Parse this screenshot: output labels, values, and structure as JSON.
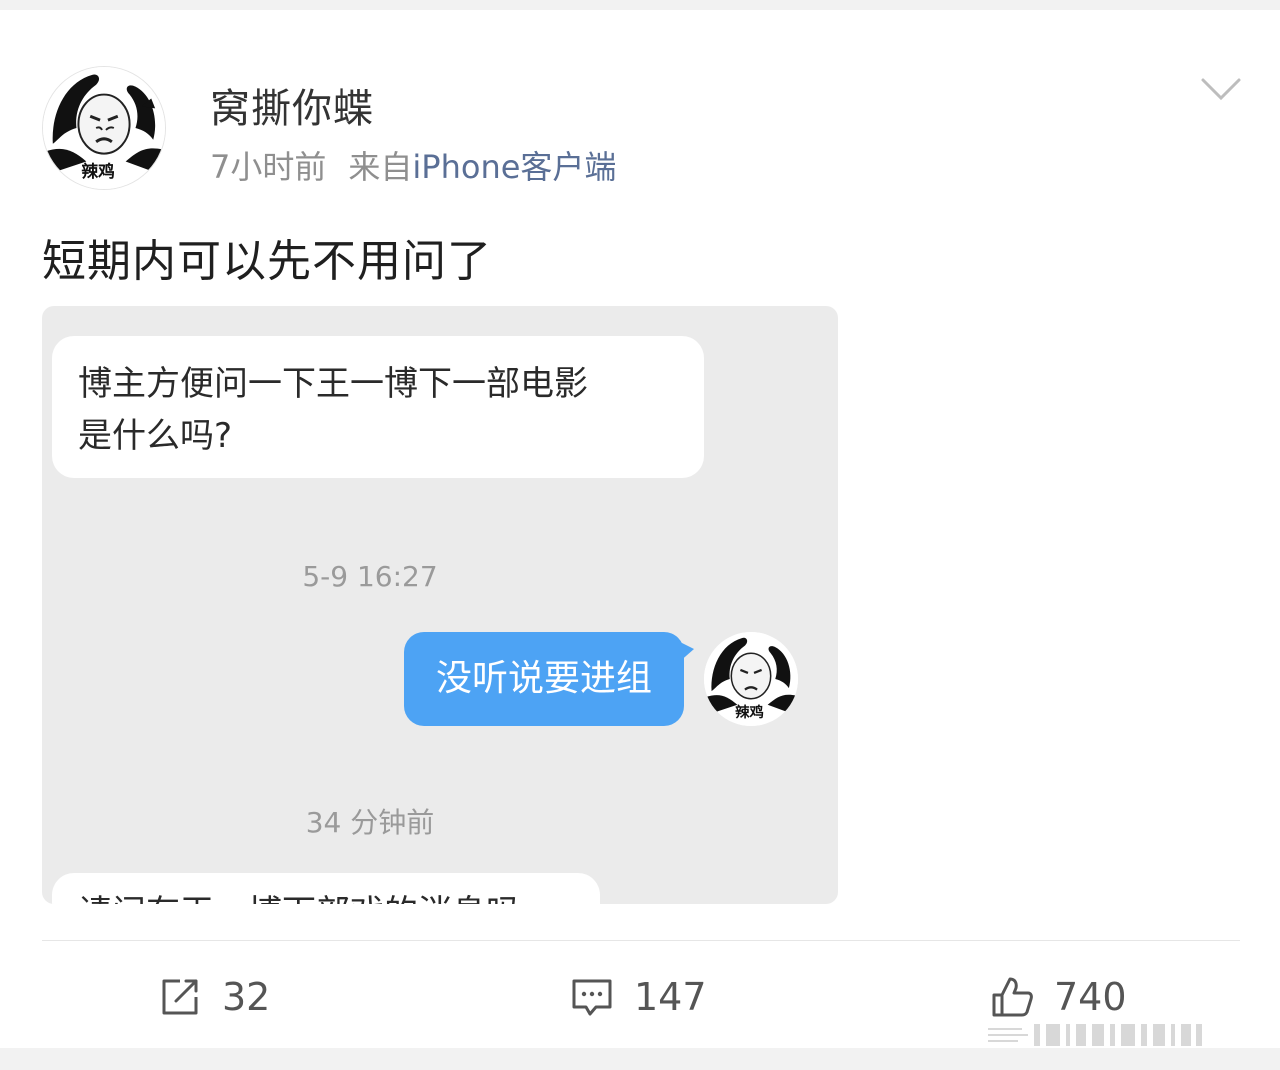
{
  "post": {
    "username": "窝撕你蝶",
    "time": "7小时前",
    "source_prefix": "来自",
    "source_client": "iPhone客户端",
    "text": "短期内可以先不用问了",
    "avatar_caption": "辣鸡",
    "more_icon": "chevron-down-icon"
  },
  "screenshot": {
    "incoming_message_1_line_1": "博主方便问一下王一博下一部电影",
    "incoming_message_1_line_2": "是什么吗?",
    "timestamp_1": "5-9 16:27",
    "outgoing_message": "没听说要进组",
    "sender_avatar_caption": "辣鸡",
    "timestamp_2": "34 分钟前",
    "incoming_message_2": "请问有王一博下部戏的消息吗"
  },
  "actions": {
    "repost": {
      "icon": "repost-icon",
      "count": "32"
    },
    "comment": {
      "icon": "comment-icon",
      "count": "147"
    },
    "like": {
      "icon": "thumbs-up-icon",
      "count": "740"
    }
  },
  "colors": {
    "outgoing_bubble": "#4da3f4",
    "client_link": "#5a6f96",
    "chat_background": "#ebebeb"
  }
}
